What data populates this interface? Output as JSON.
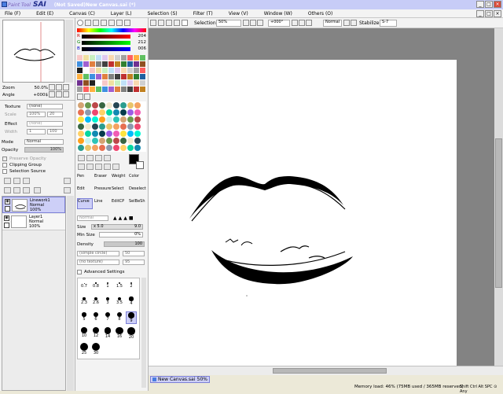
{
  "titlebar": {
    "app_prefix": "Paint Tool",
    "app_name": "SAI",
    "document": "(Not Saved)New Canvas.sai (*)",
    "minimize": "_",
    "maximize": "□",
    "close": "×"
  },
  "menu": [
    "File (F)",
    "Edit (E)",
    "Canvas (C)",
    "Layer (L)",
    "Selection (S)",
    "Filter (T)",
    "View (V)",
    "Window (W)",
    "Others (O)"
  ],
  "navigator": {
    "zoom_label": "Zoom",
    "zoom_value": "50.0%",
    "angle_label": "Angle",
    "angle_value": "+000$"
  },
  "layer_props": {
    "texture_label": "Texture",
    "texture_value": "(none)",
    "scale_label": "Scale",
    "scale_value": "100%",
    "texture_num": "20",
    "effect_label": "Effect",
    "effect_value": "(none)",
    "width_label": "Width",
    "width_num": "1",
    "effect_num": "100",
    "mode_label": "Mode",
    "mode_value": "Normal",
    "opacity_label": "Opacity",
    "opacity_value": "100%",
    "preserve_opacity": "Preserve Opacity",
    "clipping_group": "Clipping Group",
    "selection_source": "Selection Source"
  },
  "layers": [
    {
      "name": "Linework1",
      "mode": "Normal",
      "opacity": "100%",
      "selected": true
    },
    {
      "name": "Layer1",
      "mode": "Normal",
      "opacity": "100%",
      "selected": false
    }
  ],
  "color_sliders": {
    "r": "204",
    "g": "212",
    "b": "006",
    "r_label": "R",
    "g_label": "G",
    "b_label": "B"
  },
  "tools": {
    "row1": [
      "Pen",
      "Eraser",
      "Weight",
      "Color"
    ],
    "row2": [
      "Edit",
      "Pressure",
      "Select",
      "Deselect"
    ],
    "row3": [
      "Curve",
      "Line",
      "EditCP",
      "SelBeSh"
    ]
  },
  "brush": {
    "blend": "Normal",
    "size_label": "Size",
    "size_mult": "x 5.0",
    "size_value": "9.0",
    "minsize_label": "Min Size",
    "minsize_value": "0%",
    "density_label": "Density",
    "density_value": "100",
    "shape": "(simple circle)",
    "texture": "(no texture)",
    "shape_num": "50",
    "texture_num": "95",
    "advanced": "Advanced Settings"
  },
  "brush_sizes": [
    [
      "0.7",
      "0.8",
      "1",
      "1.5",
      "2"
    ],
    [
      "2.3",
      "2.6",
      "3",
      "3.5",
      "4"
    ],
    [
      "5",
      "6",
      "7",
      "8",
      "9"
    ],
    [
      "10",
      "12",
      "14",
      "16",
      "20"
    ],
    [
      "25",
      "30"
    ]
  ],
  "canvas_toolbar": {
    "selection": "Selection",
    "zoom": "50%",
    "angle": "+000°",
    "blend": "Normal",
    "stabilize_label": "Stabilize",
    "stabilize_value": "S-7"
  },
  "canvas_tab": {
    "name": "New Canvas.sai",
    "zoom": "50%"
  },
  "status": {
    "memory": "Memory load: 46% (75MB used / 365MB reserved)",
    "keys": "Shift Ctrl Alt SPC ⊙ Any"
  },
  "colors": {
    "title_bg": "#c7ccf7",
    "selected_layer": "#cdcff7",
    "canvas_bg": "#838383"
  }
}
